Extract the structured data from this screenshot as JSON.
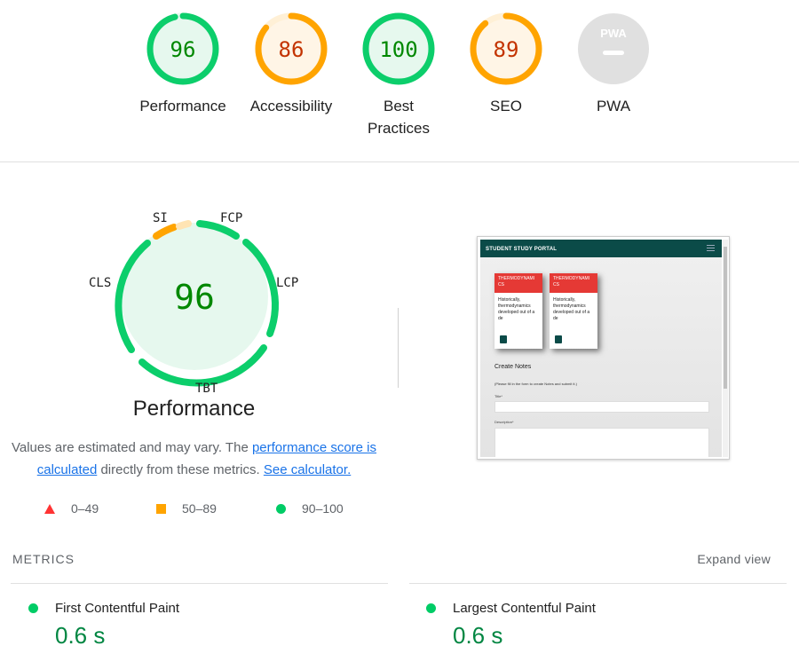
{
  "colors": {
    "pass": "#0cce6b",
    "average": "#ffa400",
    "fail": "#ff3333",
    "pass_text": "#008800",
    "average_text": "#c33300"
  },
  "gauges": [
    {
      "score": "96",
      "label": "Performance",
      "rating": "pass",
      "fraction": 0.96
    },
    {
      "score": "86",
      "label": "Accessibility",
      "rating": "average",
      "fraction": 0.86
    },
    {
      "score": "100",
      "label": "Best Practices",
      "rating": "pass",
      "fraction": 1.0
    },
    {
      "score": "89",
      "label": "SEO",
      "rating": "average",
      "fraction": 0.89
    },
    {
      "score": "",
      "label": "PWA",
      "rating": "na",
      "badge": "PWA"
    }
  ],
  "performance": {
    "score": "96",
    "fraction": 0.96,
    "title": "Performance",
    "metric_labels": {
      "si": "SI",
      "fcp": "FCP",
      "lcp": "LCP",
      "tbt": "TBT",
      "cls": "CLS"
    },
    "note_pre": "Values are estimated and may vary. The ",
    "note_link1": "performance score is calculated",
    "note_mid": " directly from these metrics. ",
    "note_link2": "See calculator."
  },
  "legend": [
    {
      "range": "0–49",
      "shape": "triangle"
    },
    {
      "range": "50–89",
      "shape": "square"
    },
    {
      "range": "90–100",
      "shape": "circle"
    }
  ],
  "screenshot": {
    "brand": "STUDENT STUDY PORTAL",
    "cards": [
      {
        "head": "THERMODYNAMI CS",
        "body": "Historically, thermodynamics developed out of a de"
      },
      {
        "head": "THERMODYNAMI CS",
        "body": "Historically, thermodynamics developed out of a de"
      }
    ],
    "heading": "Create Notes",
    "instructions": "(Please fill in the form to create Notes and submit it.)",
    "title_label": "Title*",
    "description_label": "Description*"
  },
  "metrics": {
    "header": "METRICS",
    "expand": "Expand view",
    "items": [
      {
        "name": "First Contentful Paint",
        "value": "0.6 s"
      },
      {
        "name": "Largest Contentful Paint",
        "value": "0.6 s"
      }
    ]
  }
}
